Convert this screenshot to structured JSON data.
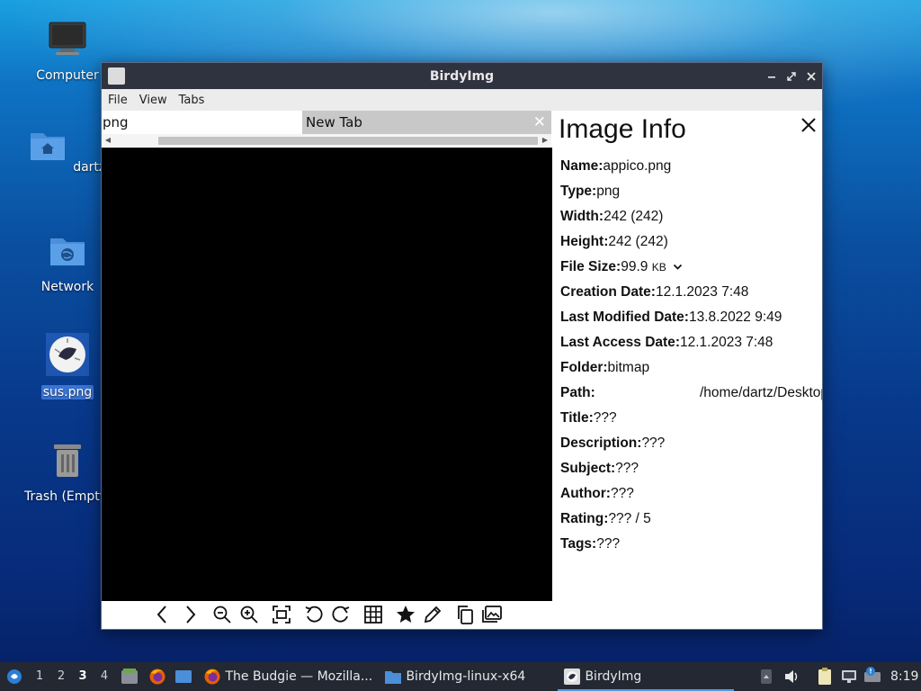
{
  "desktop": {
    "icons": [
      {
        "label": "Computer"
      },
      {
        "label": "dartz"
      },
      {
        "label": "Network"
      },
      {
        "label": "sus.png"
      },
      {
        "label": "Trash (Empty)"
      }
    ]
  },
  "window": {
    "title": "BirdyImg",
    "menu": [
      "File",
      "View",
      "Tabs"
    ],
    "tabs": [
      {
        "label": "png"
      },
      {
        "label": "New Tab"
      }
    ],
    "toolbar_icons": [
      "prev-icon",
      "next-icon",
      "zoom-out-icon",
      "zoom-in-icon",
      "fit-icon",
      "rotate-left-icon",
      "rotate-right-icon",
      "grid-icon",
      "star-icon",
      "edit-icon",
      "copy-icon",
      "gallery-icon"
    ]
  },
  "image_info": {
    "heading": "Image Info",
    "fields": [
      {
        "key": "Name",
        "value": "appico.png"
      },
      {
        "key": "Type",
        "value": "png"
      },
      {
        "key": "Width",
        "value": "242 (242)"
      },
      {
        "key": "Height",
        "value": "242 (242)"
      },
      {
        "key": "File Size",
        "value": "99.9",
        "unit": "KB"
      },
      {
        "key": "Creation Date",
        "value": "12.1.2023 7:48"
      },
      {
        "key": "Last Modified Date",
        "value": "13.8.2022 9:49"
      },
      {
        "key": "Last Access Date",
        "value": "12.1.2023 7:48"
      },
      {
        "key": "Folder",
        "value": "bitmap"
      },
      {
        "key": "Path",
        "value": "/home/dartz/Desktop"
      },
      {
        "key": "Title",
        "value": "???"
      },
      {
        "key": "Description",
        "value": "???"
      },
      {
        "key": "Subject",
        "value": "???"
      },
      {
        "key": "Author",
        "value": "???"
      },
      {
        "key": "Rating",
        "value": "??? / 5"
      },
      {
        "key": "Tags",
        "value": "???"
      }
    ]
  },
  "taskbar": {
    "workspaces": [
      "1",
      "2",
      "3",
      "4"
    ],
    "active_workspace": "3",
    "tasks": [
      {
        "label": "The Budgie — Mozilla..."
      },
      {
        "label": "BirdyImg-linux-x64"
      },
      {
        "label": "BirdyImg"
      }
    ],
    "clock": "8:19"
  },
  "colors": {
    "titlebar": "#2f3340",
    "taskbar": "#232833",
    "selection": "#3a74d6"
  }
}
